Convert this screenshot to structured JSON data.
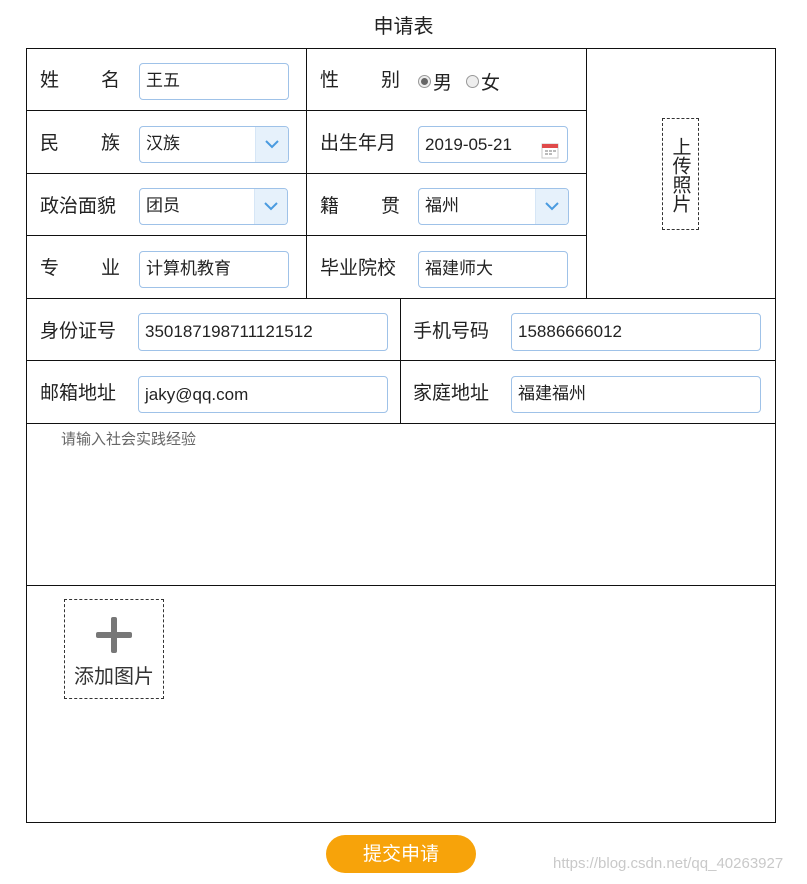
{
  "form": {
    "title": "申请表",
    "name": {
      "label": "姓名",
      "value": "王五"
    },
    "gender": {
      "label": "性别",
      "options": [
        "男",
        "女"
      ],
      "selected": "男"
    },
    "ethnicity": {
      "label": "民族",
      "value": "汉族"
    },
    "birth": {
      "label": "出生年月",
      "value": "2019-05-21"
    },
    "politics": {
      "label": "政治面貌",
      "value": "团员"
    },
    "native_place": {
      "label": "籍贯",
      "value": "福州"
    },
    "major": {
      "label": "专业",
      "value": "计算机教育"
    },
    "school": {
      "label": "毕业院校",
      "value": "福建师大"
    },
    "id_number": {
      "label": "身份证号",
      "value": "350187198711121512"
    },
    "phone": {
      "label": "手机号码",
      "value": "15886666012"
    },
    "email": {
      "label": "邮箱地址",
      "value": "jaky@qq.com"
    },
    "address": {
      "label": "家庭地址",
      "value": "福建福州"
    },
    "upload_photo": "上传照片",
    "experience_placeholder": "请输入社会实践经验",
    "add_image": "添加图片",
    "submit": "提交申请"
  },
  "watermark": "https://blog.csdn.net/qq_40263927",
  "colors": {
    "accent": "#f7a30a",
    "field_border": "#9fc2e8",
    "select_arrow_bg": "#e6f1fb"
  }
}
